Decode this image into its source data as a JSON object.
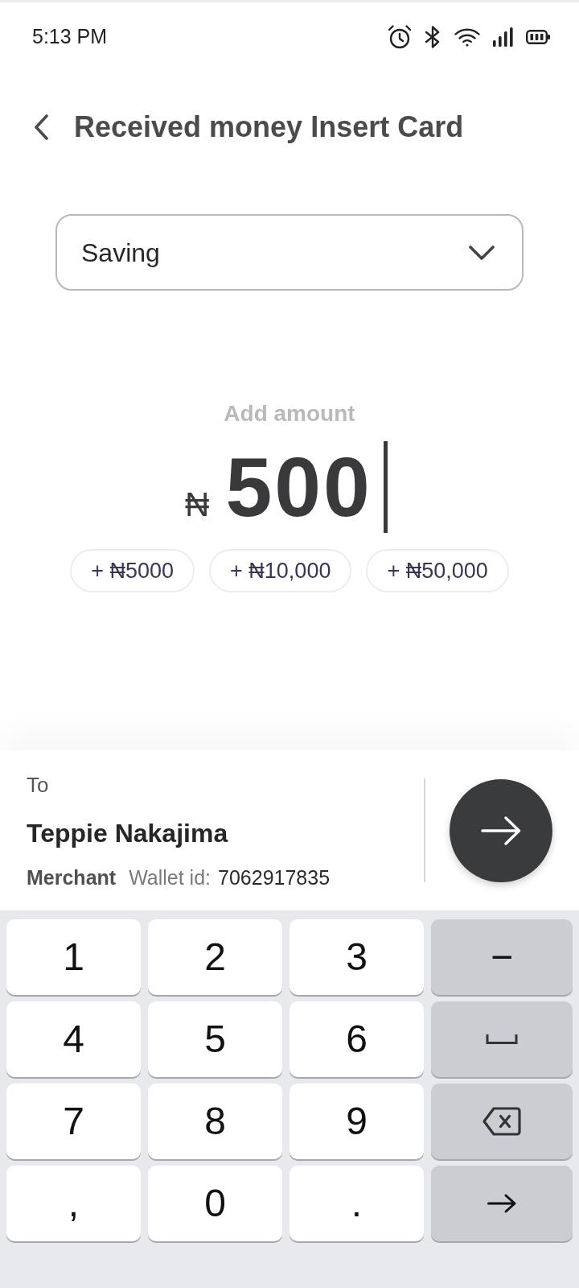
{
  "status_bar": {
    "time": "5:13 PM"
  },
  "header": {
    "title": "Received money Insert Card"
  },
  "account_select": {
    "value": "Saving"
  },
  "amount": {
    "label": "Add amount",
    "currency": "₦",
    "value": "500"
  },
  "quick_amounts": [
    "+ ₦5000",
    "+ ₦10,000",
    "+ ₦50,000"
  ],
  "recipient": {
    "label": "To",
    "name": "Teppie Nakajima",
    "type": "Merchant",
    "wallet_label": "Wallet id:",
    "wallet_id": "7062917835"
  },
  "keyboard": {
    "rows": [
      [
        {
          "kind": "char",
          "label": "1"
        },
        {
          "kind": "char",
          "label": "2"
        },
        {
          "kind": "char",
          "label": "3"
        },
        {
          "kind": "symbol",
          "label": "−"
        }
      ],
      [
        {
          "kind": "char",
          "label": "4"
        },
        {
          "kind": "char",
          "label": "5"
        },
        {
          "kind": "char",
          "label": "6"
        },
        {
          "kind": "space"
        }
      ],
      [
        {
          "kind": "char",
          "label": "7"
        },
        {
          "kind": "char",
          "label": "8"
        },
        {
          "kind": "char",
          "label": "9"
        },
        {
          "kind": "backspace"
        }
      ],
      [
        {
          "kind": "char",
          "label": ","
        },
        {
          "kind": "char",
          "label": "0"
        },
        {
          "kind": "char",
          "label": "."
        },
        {
          "kind": "enter"
        }
      ]
    ]
  }
}
